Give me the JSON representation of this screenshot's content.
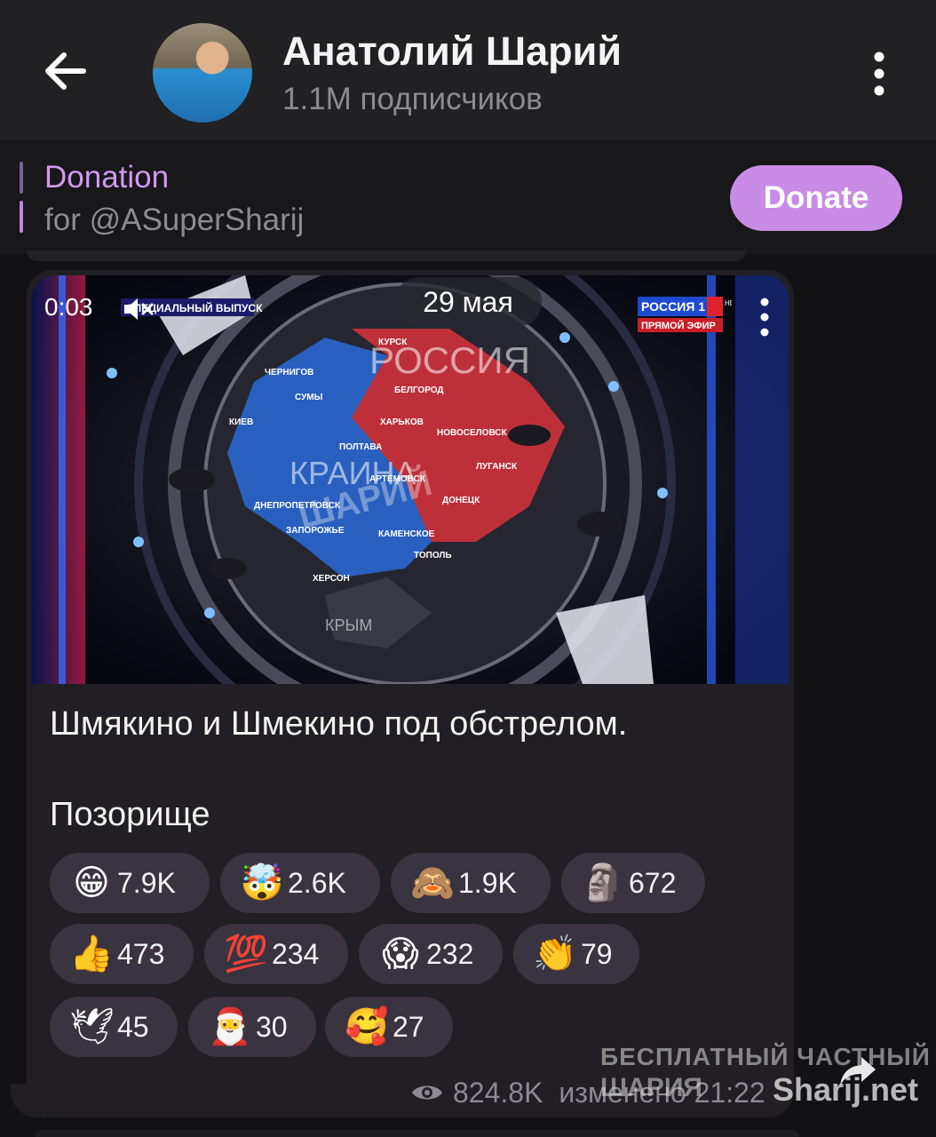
{
  "header": {
    "title": "Анатолий Шарий",
    "subtitle": "1.1M подписчиков",
    "back_icon": "arrow-left-icon",
    "menu_icon": "more-vertical-icon"
  },
  "donation": {
    "title": "Donation",
    "subtitle": "for @ASuperSharij",
    "button": "Donate",
    "accent": "#c98ce6"
  },
  "video": {
    "time": "0:03",
    "date": "29 мая",
    "channel": "РОССИЯ 1",
    "channel_sub": "ПРЯМОЙ ЭФИР",
    "hd": "HD",
    "banner": "СПЕЦИАЛЬНЫЙ ВЫПУСК",
    "map": {
      "russia": "РОССИЯ",
      "ukraine": "КРАИНА",
      "crimea": "КРЫМ",
      "cities": [
        "КУРСК",
        "БЕЛГОРОД",
        "ЧЕРНИГОВ",
        "СУМЫ",
        "ХАРЬКОВ",
        "КИЕВ",
        "ПОЛТАВА",
        "НОВОСЕЛОВСК",
        "ЛУГАНСК",
        "АРТЕМОВСК",
        "ДНЕПРОПЕТРОВСК",
        "ДОНЕЦК",
        "ЗАПОРОЖЬЕ",
        "КАМЕНСКОЕ",
        "ТОПОЛЬ",
        "ХЕРСОН"
      ]
    },
    "watermark": "ШАРИЙ"
  },
  "message": {
    "line1": "Шмякино и Шмекино под обстрелом.",
    "line2": "Позорище"
  },
  "reactions": [
    {
      "emoji": "😁",
      "count": "7.9K"
    },
    {
      "emoji": "🤯",
      "count": "2.6K"
    },
    {
      "emoji": "🙈",
      "count": "1.9K"
    },
    {
      "emoji": "🗿",
      "count": "672"
    },
    {
      "emoji": "👍",
      "count": "473"
    },
    {
      "emoji": "💯",
      "count": "234"
    },
    {
      "emoji": "😱",
      "count": "232"
    },
    {
      "emoji": "👏",
      "count": "79"
    },
    {
      "emoji": "🕊",
      "count": "45"
    },
    {
      "emoji": "🎅",
      "count": "30"
    },
    {
      "emoji": "🥰",
      "count": "27"
    }
  ],
  "footer": {
    "views": "824.8K",
    "edited": "изменено 21:22",
    "view_icon": "eye-icon",
    "share_icon": "share-icon"
  },
  "watermark": {
    "line1": "БЕСПЛАТНЫЙ ЧАСТНЫЙ",
    "line2": "ШАРИЯ",
    "site": "Sharij.net"
  }
}
